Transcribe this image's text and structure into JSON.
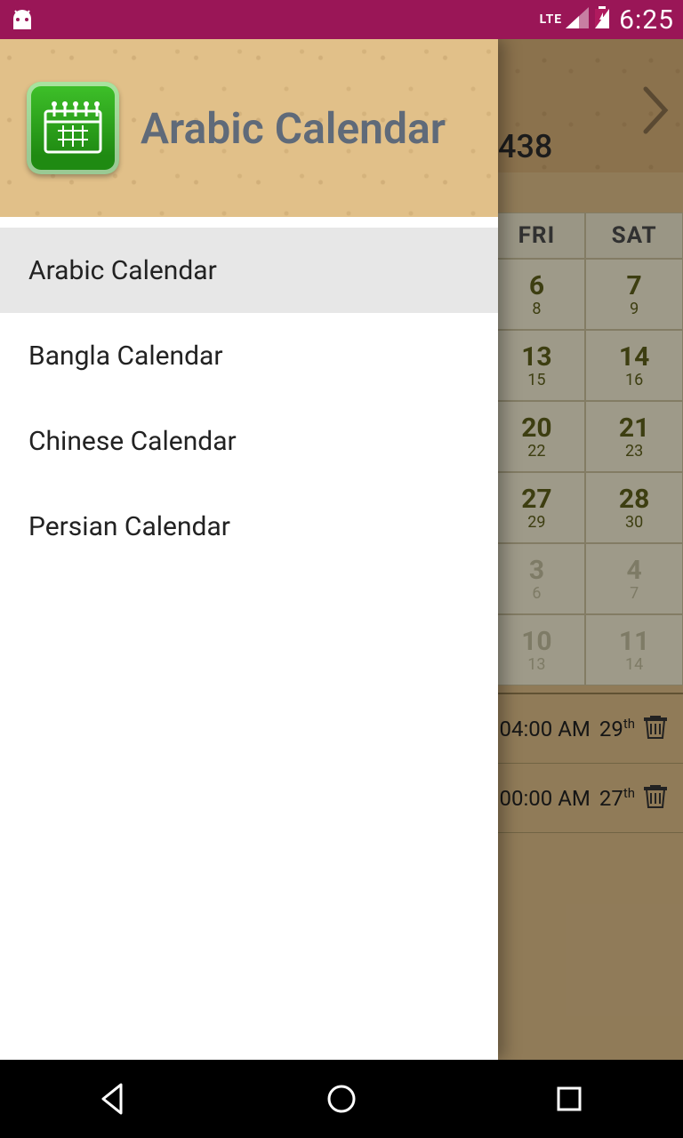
{
  "statusbar": {
    "network_label": "LTE",
    "time": "6:25"
  },
  "drawer": {
    "title": "Arabic Calendar",
    "items": [
      {
        "label": "Arabic Calendar",
        "selected": true
      },
      {
        "label": "Bangla Calendar",
        "selected": false
      },
      {
        "label": "Chinese Calendar",
        "selected": false
      },
      {
        "label": "Persian Calendar",
        "selected": false
      }
    ]
  },
  "calendar": {
    "month_year_partial": "438",
    "day_headers_visible": [
      "FRI",
      "SAT"
    ],
    "visible_cells": [
      {
        "hijri": "6",
        "greg": "8",
        "out": false
      },
      {
        "hijri": "7",
        "greg": "9",
        "out": false
      },
      {
        "hijri": "13",
        "greg": "15",
        "out": false
      },
      {
        "hijri": "14",
        "greg": "16",
        "out": false
      },
      {
        "hijri": "20",
        "greg": "22",
        "out": false
      },
      {
        "hijri": "21",
        "greg": "23",
        "out": false
      },
      {
        "hijri": "27",
        "greg": "29",
        "out": false
      },
      {
        "hijri": "28",
        "greg": "30",
        "out": false
      },
      {
        "hijri": "3",
        "greg": "6",
        "out": true
      },
      {
        "hijri": "4",
        "greg": "7",
        "out": true
      },
      {
        "hijri": "10",
        "greg": "13",
        "out": true
      },
      {
        "hijri": "11",
        "greg": "14",
        "out": true
      }
    ]
  },
  "events": [
    {
      "time": "04:00 AM",
      "day": "29",
      "ord": "th"
    },
    {
      "time": "00:00 AM",
      "day": "27",
      "ord": "th"
    }
  ]
}
